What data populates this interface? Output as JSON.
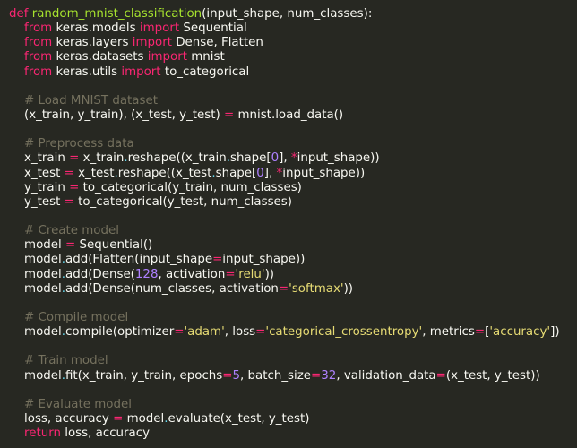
{
  "code_lines": [
    [
      [
        "kw",
        "def"
      ],
      [
        "t",
        " "
      ],
      [
        "fn",
        "random_mnist_classification"
      ],
      [
        "t",
        "(input_shape, num_classes):"
      ]
    ],
    [
      [
        "t",
        "    "
      ],
      [
        "kw",
        "from"
      ],
      [
        "t",
        " keras.models "
      ],
      [
        "kw",
        "import"
      ],
      [
        "t",
        " Sequential"
      ]
    ],
    [
      [
        "t",
        "    "
      ],
      [
        "kw",
        "from"
      ],
      [
        "t",
        " keras.layers "
      ],
      [
        "kw",
        "import"
      ],
      [
        "t",
        " Dense, Flatten"
      ]
    ],
    [
      [
        "t",
        "    "
      ],
      [
        "kw",
        "from"
      ],
      [
        "t",
        " keras.datasets "
      ],
      [
        "kw",
        "import"
      ],
      [
        "t",
        " mnist"
      ]
    ],
    [
      [
        "t",
        "    "
      ],
      [
        "kw",
        "from"
      ],
      [
        "t",
        " keras.utils "
      ],
      [
        "kw",
        "import"
      ],
      [
        "t",
        " to_categorical"
      ]
    ],
    [],
    [
      [
        "t",
        "    "
      ],
      [
        "cmt",
        "# Load MNIST dataset"
      ]
    ],
    [
      [
        "t",
        "    (x_train, y_train), (x_test, y_test) "
      ],
      [
        "op",
        "="
      ],
      [
        "t",
        " mnist.load_data()"
      ]
    ],
    [],
    [
      [
        "t",
        "    "
      ],
      [
        "cmt",
        "# Preprocess data"
      ]
    ],
    [
      [
        "t",
        "    x_train "
      ],
      [
        "op",
        "="
      ],
      [
        "t",
        " x_train"
      ],
      [
        "bi",
        "."
      ],
      [
        "t",
        "reshape((x_train"
      ],
      [
        "bi",
        "."
      ],
      [
        "t",
        "shape["
      ],
      [
        "num",
        "0"
      ],
      [
        "t",
        "], "
      ],
      [
        "op",
        "*"
      ],
      [
        "t",
        "input_shape))"
      ]
    ],
    [
      [
        "t",
        "    x_test "
      ],
      [
        "op",
        "="
      ],
      [
        "t",
        " x_test"
      ],
      [
        "bi",
        "."
      ],
      [
        "t",
        "reshape((x_test"
      ],
      [
        "bi",
        "."
      ],
      [
        "t",
        "shape["
      ],
      [
        "num",
        "0"
      ],
      [
        "t",
        "], "
      ],
      [
        "op",
        "*"
      ],
      [
        "t",
        "input_shape))"
      ]
    ],
    [
      [
        "t",
        "    y_train "
      ],
      [
        "op",
        "="
      ],
      [
        "t",
        " to_categorical(y_train, num_classes)"
      ]
    ],
    [
      [
        "t",
        "    y_test "
      ],
      [
        "op",
        "="
      ],
      [
        "t",
        " to_categorical(y_test, num_classes)"
      ]
    ],
    [],
    [
      [
        "t",
        "    "
      ],
      [
        "cmt",
        "# Create model"
      ]
    ],
    [
      [
        "t",
        "    model "
      ],
      [
        "op",
        "="
      ],
      [
        "t",
        " Sequential()"
      ]
    ],
    [
      [
        "t",
        "    model"
      ],
      [
        "bi",
        "."
      ],
      [
        "t",
        "add(Flatten(input_shape"
      ],
      [
        "op",
        "="
      ],
      [
        "t",
        "input_shape))"
      ]
    ],
    [
      [
        "t",
        "    model"
      ],
      [
        "bi",
        "."
      ],
      [
        "t",
        "add(Dense("
      ],
      [
        "num",
        "128"
      ],
      [
        "t",
        ", activation"
      ],
      [
        "op",
        "="
      ],
      [
        "str",
        "'relu'"
      ],
      [
        "t",
        "))"
      ]
    ],
    [
      [
        "t",
        "    model"
      ],
      [
        "bi",
        "."
      ],
      [
        "t",
        "add(Dense(num_classes, activation"
      ],
      [
        "op",
        "="
      ],
      [
        "str",
        "'softmax'"
      ],
      [
        "t",
        "))"
      ]
    ],
    [],
    [
      [
        "t",
        "    "
      ],
      [
        "cmt",
        "# Compile model"
      ]
    ],
    [
      [
        "t",
        "    model"
      ],
      [
        "bi",
        "."
      ],
      [
        "t",
        "compile(optimizer"
      ],
      [
        "op",
        "="
      ],
      [
        "str",
        "'adam'"
      ],
      [
        "t",
        ", loss"
      ],
      [
        "op",
        "="
      ],
      [
        "str",
        "'categorical_crossentropy'"
      ],
      [
        "t",
        ", metrics"
      ],
      [
        "op",
        "="
      ],
      [
        "t",
        "["
      ],
      [
        "str",
        "'accuracy'"
      ],
      [
        "t",
        "])"
      ]
    ],
    [],
    [
      [
        "t",
        "    "
      ],
      [
        "cmt",
        "# Train model"
      ]
    ],
    [
      [
        "t",
        "    model"
      ],
      [
        "bi",
        "."
      ],
      [
        "t",
        "fit(x_train, y_train, epochs"
      ],
      [
        "op",
        "="
      ],
      [
        "num",
        "5"
      ],
      [
        "t",
        ", batch_size"
      ],
      [
        "op",
        "="
      ],
      [
        "num",
        "32"
      ],
      [
        "t",
        ", validation_data"
      ],
      [
        "op",
        "="
      ],
      [
        "t",
        "(x_test, y_test))"
      ]
    ],
    [],
    [
      [
        "t",
        "    "
      ],
      [
        "cmt",
        "# Evaluate model"
      ]
    ],
    [
      [
        "t",
        "    loss, accuracy "
      ],
      [
        "op",
        "="
      ],
      [
        "t",
        " model"
      ],
      [
        "bi",
        "."
      ],
      [
        "t",
        "evaluate(x_test, y_test)"
      ]
    ],
    [
      [
        "t",
        "    "
      ],
      [
        "kw",
        "return"
      ],
      [
        "t",
        " loss, accuracy"
      ]
    ]
  ],
  "colors": {
    "background": "#272822",
    "text": "#f8f8f2",
    "keyword": "#f92672",
    "function": "#a6e22e",
    "string": "#e6db74",
    "number": "#ae81ff",
    "comment": "#75715e"
  }
}
